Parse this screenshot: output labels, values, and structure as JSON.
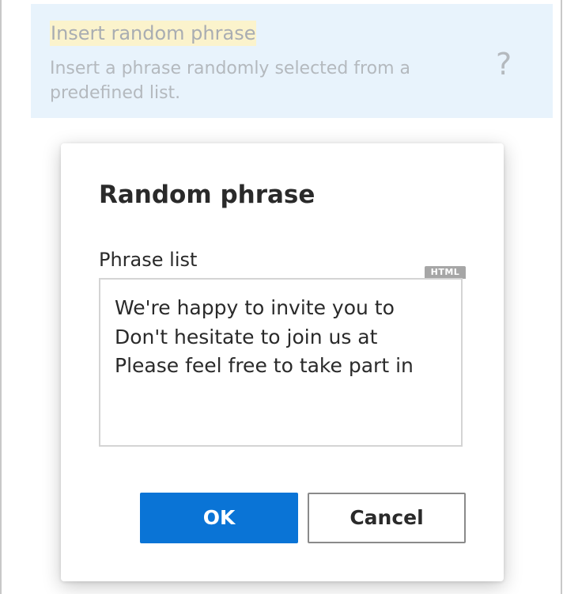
{
  "background_item": {
    "title": "Insert random phrase",
    "description": "Insert a phrase randomly selected from a predefined list.",
    "help_glyph": "?"
  },
  "dialog": {
    "title": "Random phrase",
    "field_label": "Phrase list",
    "format_badge": "HTML",
    "phrases": [
      "We're happy to invite you to",
      "Don't hesitate to join us at",
      "Please feel free to take part in"
    ],
    "ok_label": "OK",
    "cancel_label": "Cancel"
  },
  "colors": {
    "primary_button": "#0a74d6",
    "item_highlight": "#fbf3cc",
    "item_background": "#e8f3fc"
  }
}
